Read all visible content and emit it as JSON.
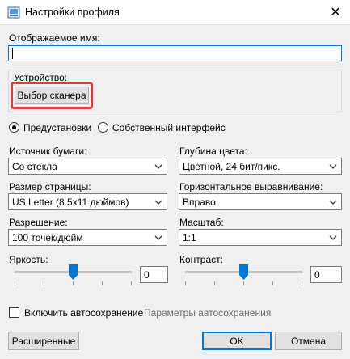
{
  "window": {
    "title": "Настройки профиля",
    "close_glyph": "✕"
  },
  "display_name": {
    "label": "Отображаемое имя:",
    "value": ""
  },
  "device": {
    "label": "Устройство:",
    "select_scanner_label": "Выбор сканера"
  },
  "mode": {
    "presets_label": "Предустановки",
    "custom_ui_label": "Собственный интерфейс",
    "selected": "presets"
  },
  "paper_source": {
    "label": "Источник бумаги:",
    "value": "Со стекла"
  },
  "color_depth": {
    "label": "Глубина цвета:",
    "value": "Цветной, 24 бит/пикс."
  },
  "page_size": {
    "label": "Размер страницы:",
    "value": "US Letter (8.5x11 дюймов)"
  },
  "horizontal_align": {
    "label": "Горизонтальное выравнивание:",
    "value": "Вправо"
  },
  "resolution": {
    "label": "Разрешение:",
    "value": "100 точек/дюйм"
  },
  "scale": {
    "label": "Масштаб:",
    "value": "1:1"
  },
  "brightness": {
    "label": "Яркость:",
    "value": "0",
    "level": 0.5
  },
  "contrast": {
    "label": "Контраст:",
    "value": "0",
    "level": 0.5
  },
  "autosave": {
    "checkbox_label": "Включить автосохранение",
    "settings_label": "Параметры автосохранения",
    "checked": false
  },
  "footer": {
    "advanced_label": "Расширенные",
    "ok_label": "OK",
    "cancel_label": "Отмена"
  }
}
